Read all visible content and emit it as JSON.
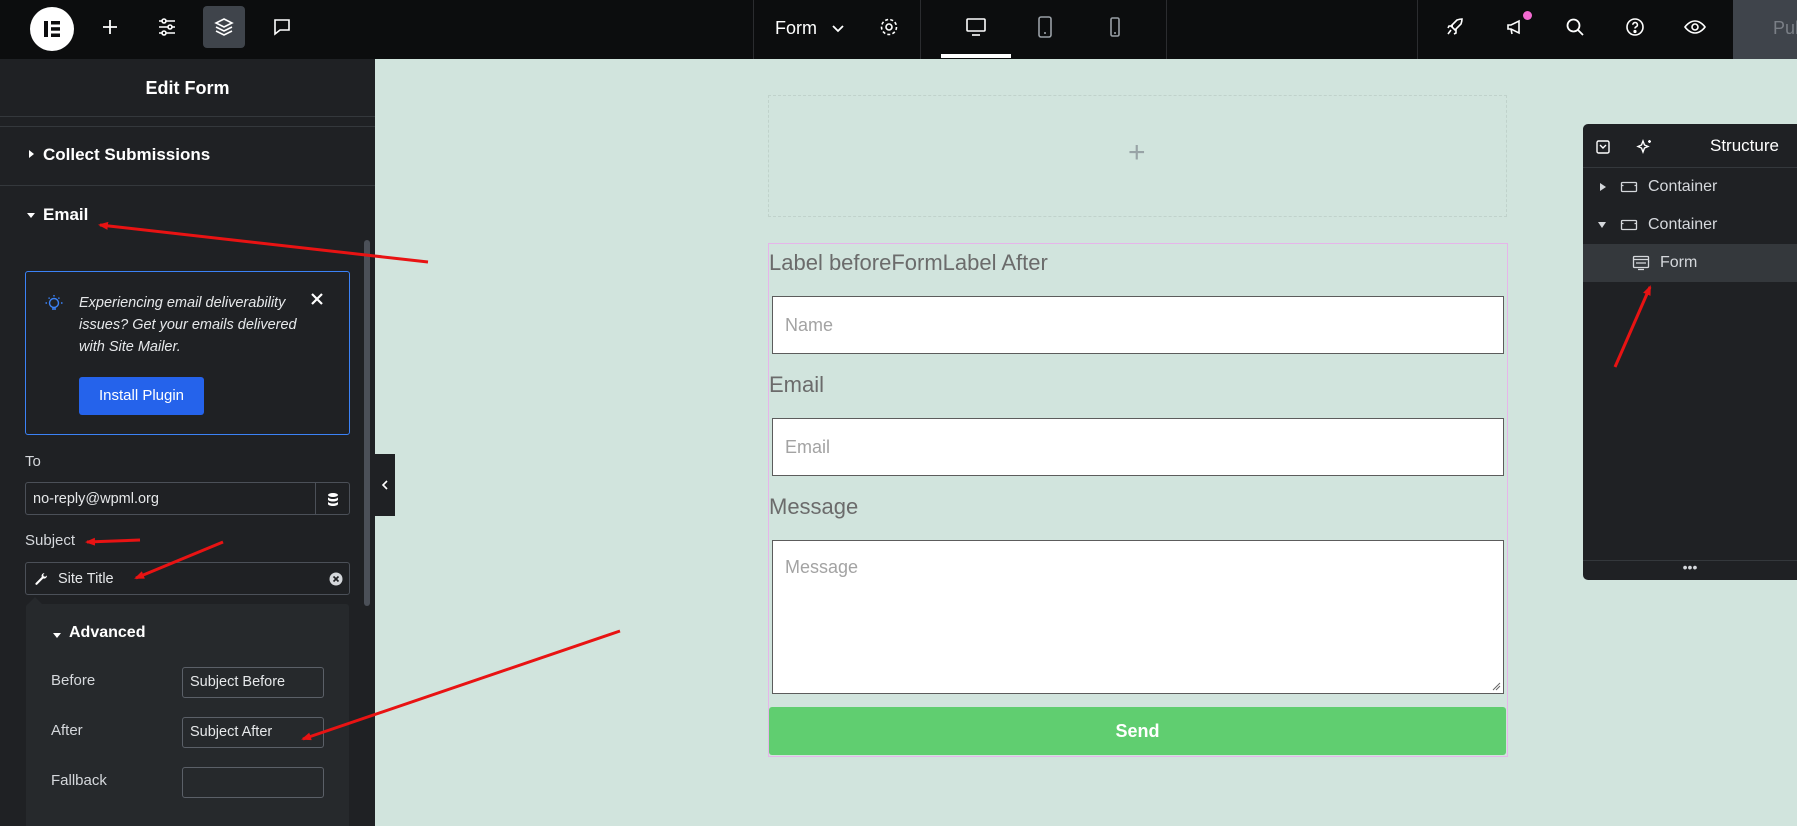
{
  "topbar": {
    "icons": [
      "elementor-logo-icon",
      "add-icon",
      "settings-sliders-icon",
      "layers-icon",
      "comment-icon",
      "settings-gear-icon",
      "desktop-icon",
      "tablet-icon",
      "mobile-icon",
      "rocket-icon",
      "megaphone-icon",
      "search-icon",
      "help-icon",
      "eye-icon"
    ],
    "document_title": "Form",
    "publish_label": "Pub"
  },
  "panel": {
    "title": "Edit Form",
    "sections": {
      "collect_submissions": "Collect Submissions",
      "email": "Email"
    },
    "notice": {
      "text": "Experiencing email deliverability issues? Get your emails delivered with Site Mailer.",
      "button": "Install Plugin"
    },
    "to": {
      "label": "To",
      "value": "no-reply@wpml.org"
    },
    "subject": {
      "label": "Subject",
      "value": "Site Title"
    },
    "advanced": {
      "title": "Advanced",
      "before_label": "Before",
      "before_value": "Subject Before",
      "after_label": "After",
      "after_value": "Subject After",
      "fallback_label": "Fallback",
      "fallback_value": ""
    }
  },
  "canvas": {
    "form_title": "Label beforeFormLabel After",
    "name_placeholder": "Name",
    "email_label": "Email",
    "email_placeholder": "Email",
    "message_label": "Message",
    "message_placeholder": "Message",
    "send_label": "Send",
    "empty_plus": "+"
  },
  "structure": {
    "title": "Structure",
    "items": [
      {
        "label": "Container",
        "expanded": false
      },
      {
        "label": "Container",
        "expanded": true
      },
      {
        "label": "Form",
        "selected": true
      }
    ],
    "footer": "•••"
  },
  "colors": {
    "canvas_bg": "#d1e4dd",
    "panel_bg": "#1f2124",
    "accent_blue": "#2563eb",
    "send_green": "#60ce70",
    "annotation_red": "#e81313"
  }
}
